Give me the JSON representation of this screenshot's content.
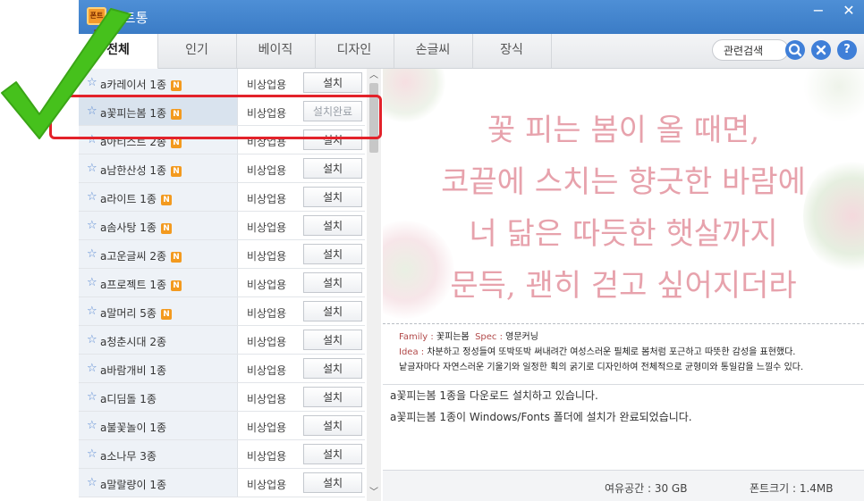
{
  "app": {
    "title": "폰트통",
    "logo_text": "폰트통",
    "minimize": "−",
    "close": "✕"
  },
  "tabs": [
    "전체",
    "인기",
    "베이직",
    "디자인",
    "손글씨",
    "장식"
  ],
  "search": {
    "related_label": "관련검색"
  },
  "list": {
    "rows": [
      {
        "name": "a카레이서 1종",
        "new": true,
        "license": "비상업용",
        "action": "설치"
      },
      {
        "name": "a꽃피는봄 1종",
        "new": true,
        "license": "비상업용",
        "action": "설치완료",
        "selected": true
      },
      {
        "name": "a아티스트 2종",
        "new": true,
        "license": "비상업용",
        "action": "설치"
      },
      {
        "name": "a남한산성 1종",
        "new": true,
        "license": "비상업용",
        "action": "설치"
      },
      {
        "name": "a라이트 1종",
        "new": true,
        "license": "비상업용",
        "action": "설치"
      },
      {
        "name": "a솜사탕 1종",
        "new": true,
        "license": "비상업용",
        "action": "설치"
      },
      {
        "name": "a고운글씨 2종",
        "new": true,
        "license": "비상업용",
        "action": "설치"
      },
      {
        "name": "a프로젝트 1종",
        "new": true,
        "license": "비상업용",
        "action": "설치"
      },
      {
        "name": "a말머리 5종",
        "new": true,
        "license": "비상업용",
        "action": "설치"
      },
      {
        "name": "a청춘시대 2종",
        "new": false,
        "license": "비상업용",
        "action": "설치"
      },
      {
        "name": "a바람개비 1종",
        "new": false,
        "license": "비상업용",
        "action": "설치"
      },
      {
        "name": "a디딤돌 1종",
        "new": false,
        "license": "비상업용",
        "action": "설치"
      },
      {
        "name": "a불꽃놀이 1종",
        "new": false,
        "license": "비상업용",
        "action": "설치"
      },
      {
        "name": "a소나무 3종",
        "new": false,
        "license": "비상업용",
        "action": "설치"
      },
      {
        "name": "a말랄량이 1종",
        "new": false,
        "license": "비상업용",
        "action": "설치"
      }
    ]
  },
  "preview": {
    "lines": [
      "꽃 피는 봄이 올 때면,",
      "코끝에 스치는 향긋한 바람에",
      "너 닮은 따듯한 햇살까지",
      "문득, 괜히 걷고 싶어지더라"
    ]
  },
  "info": {
    "family_label": "Family : ",
    "family_value": "꽃피는봄",
    "spec_label": "Spec : ",
    "spec_value": "영문커닝",
    "idea_label": "Idea : ",
    "idea_line1": "차분하고 정성들여 또박또박 써내려간 여성스러운 필체로 봄처럼 포근하고 따뜻한 감성을 표현했다.",
    "idea_line2": "낱글자마다 자연스러운 기울기와 일정한 획의 굵기로 디자인하여 전체적으로 균형미와 통일감을 느낄수 있다."
  },
  "log": [
    "a꽃피는봄 1종을 다운로드 설치하고 있습니다.",
    "a꽃피는봄 1종이 Windows/Fonts 폴더에 설치가 완료되었습니다."
  ],
  "status": {
    "free_space": "여유공간 :  30 GB",
    "font_size": "폰트크기 :  1.4MB"
  },
  "colors": {
    "titlebar": "#3b7cc6",
    "accent_icon": "#3f7fd8",
    "new_badge": "#f39a1f",
    "preview_text": "#e7a2ac",
    "highlight": "#e3222a",
    "checkmark": "#46c11c"
  },
  "icons": {
    "search": "search-icon",
    "clear": "clear-icon",
    "help": "help-icon",
    "favorite": "star-icon"
  }
}
